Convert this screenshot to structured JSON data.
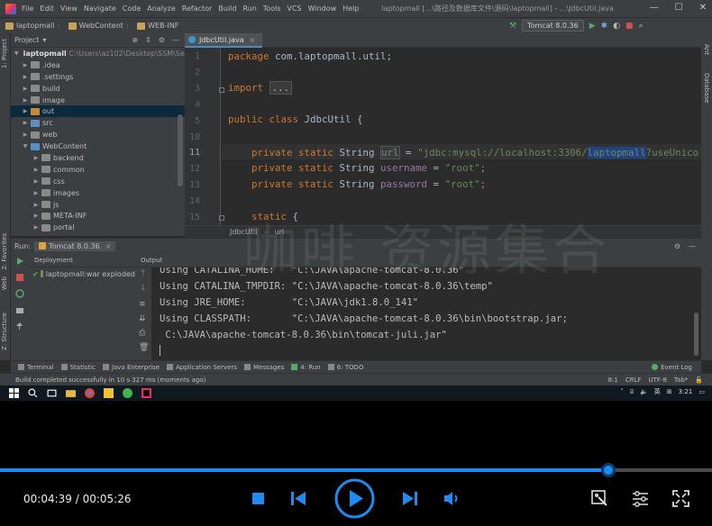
{
  "menubar": {
    "items": [
      "File",
      "Edit",
      "View",
      "Navigate",
      "Code",
      "Analyze",
      "Refactor",
      "Build",
      "Run",
      "Tools",
      "VCS",
      "Window",
      "Help"
    ],
    "title": "laptopmall [...\\路径及数据库文件\\源码\\laptopmall] - ...\\JdbcUtil.java"
  },
  "navbar": {
    "crumbs": [
      "laptopmall",
      "WebContent",
      "WEB-INF"
    ],
    "run_config": "Tomcat 8.0.36"
  },
  "left_strip": {
    "project": "1: Project",
    "favorites": "2: Favorites",
    "web": "Web",
    "structure": "Z: Structure"
  },
  "right_strip": {
    "ant": "Ant",
    "database": "Database"
  },
  "project": {
    "header": "Project",
    "tree": [
      {
        "label": "laptopmall",
        "suffix": "C:\\Users\\az102\\Desktop\\SSM\\Sen",
        "depth": 0,
        "arrow": "▼",
        "kind": "root"
      },
      {
        "label": ".idea",
        "depth": 1,
        "arrow": "▶",
        "kind": "gray"
      },
      {
        "label": ".settings",
        "depth": 1,
        "arrow": "▶",
        "kind": "gray"
      },
      {
        "label": "build",
        "depth": 1,
        "arrow": "▶",
        "kind": "gray"
      },
      {
        "label": "image",
        "depth": 1,
        "arrow": "▶",
        "kind": "gray"
      },
      {
        "label": "out",
        "depth": 1,
        "arrow": "▶",
        "kind": "orange",
        "selected": true
      },
      {
        "label": "src",
        "depth": 1,
        "arrow": "▶",
        "kind": "blue"
      },
      {
        "label": "web",
        "depth": 1,
        "arrow": "▶",
        "kind": "gray"
      },
      {
        "label": "WebContent",
        "depth": 1,
        "arrow": "▼",
        "kind": "web"
      },
      {
        "label": "backend",
        "depth": 2,
        "arrow": "▶",
        "kind": "gray"
      },
      {
        "label": "common",
        "depth": 2,
        "arrow": "▶",
        "kind": "gray"
      },
      {
        "label": "css",
        "depth": 2,
        "arrow": "▶",
        "kind": "gray"
      },
      {
        "label": "images",
        "depth": 2,
        "arrow": "▶",
        "kind": "gray"
      },
      {
        "label": "js",
        "depth": 2,
        "arrow": "▶",
        "kind": "gray"
      },
      {
        "label": "META-INF",
        "depth": 2,
        "arrow": "▶",
        "kind": "gray"
      },
      {
        "label": "portal",
        "depth": 2,
        "arrow": "▶",
        "kind": "gray"
      }
    ]
  },
  "editor": {
    "tab": "JdbcUtil.java",
    "line_numbers": [
      "1",
      "2",
      "3",
      "4",
      "5",
      "6",
      "7",
      "8",
      "9",
      "10",
      "11",
      "12",
      "13",
      "14",
      "15"
    ],
    "current_line": "11",
    "code": {
      "l1_kw": "package",
      "l1_rest": " com.laptopmall.util;",
      "l3_kw": "import",
      "l3_fold": "...",
      "l5_kw": "public class",
      "l5_rest": " JdbcUtil {",
      "l11_kw": "private static",
      "l11_type": " String ",
      "l11_fld": "url",
      "l11_eq": " = ",
      "l11_str1": "\"jdbc:mysql://localhost:3306/",
      "l11_sel": "laptopmall",
      "l11_str2": "?useUnico",
      "l12_kw": "private static",
      "l12_type": " String ",
      "l12_fld": "username",
      "l12_eq": " = ",
      "l12_str": "\"root\"",
      "l12_end": ";",
      "l13_kw": "private static",
      "l13_type": " String ",
      "l13_fld": "password",
      "l13_eq": " = ",
      "l13_str": "\"root\"",
      "l13_end": ";",
      "l15_kw": "static",
      "l15_rest": " {"
    },
    "breadcrumb": [
      "JdbcUtil",
      "url"
    ]
  },
  "run_panel": {
    "label": "Run:",
    "tab": "Tomcat 8.0.36",
    "deployment_header": "Deployment",
    "deployment_item": "laptopmall:war exploded",
    "output_header": "Output",
    "console_lines": [
      "Using CATALINA_HOME:   \"C:\\JAVA\\apache-tomcat-8.0.36\"",
      "Using CATALINA_TMPDIR: \"C:\\JAVA\\apache-tomcat-8.0.36\\temp\"",
      "Using JRE_HOME:        \"C:\\JAVA\\jdk1.8.0_141\"",
      "Using CLASSPATH:       \"C:\\JAVA\\apache-tomcat-8.0.36\\bin\\bootstrap.jar;",
      " C:\\JAVA\\apache-tomcat-8.0.36\\bin\\tomcat-juli.jar\""
    ]
  },
  "bottom_tabs": [
    "Terminal",
    "Statistic",
    "Java Enterprise",
    "Application Servers",
    "Messages",
    "4: Run",
    "6: TODO"
  ],
  "event_log": "Event Log",
  "status": {
    "message": "Build completed successfully in 10 s 327 ms (moments ago)",
    "position": "8:1",
    "line_sep": "CRLF",
    "encoding": "UTF-8",
    "indent": "Tab*"
  },
  "taskbar": {
    "time": "3:21",
    "lang": "英"
  },
  "player": {
    "time": "00:04:39 / 00:05:26",
    "progress": 0.855
  },
  "watermark": "咖啡 资源集合",
  "colors": {
    "accent": "#1d8bf0",
    "keyword": "#cc7832",
    "string": "#6a8759",
    "field": "#9876aa"
  }
}
